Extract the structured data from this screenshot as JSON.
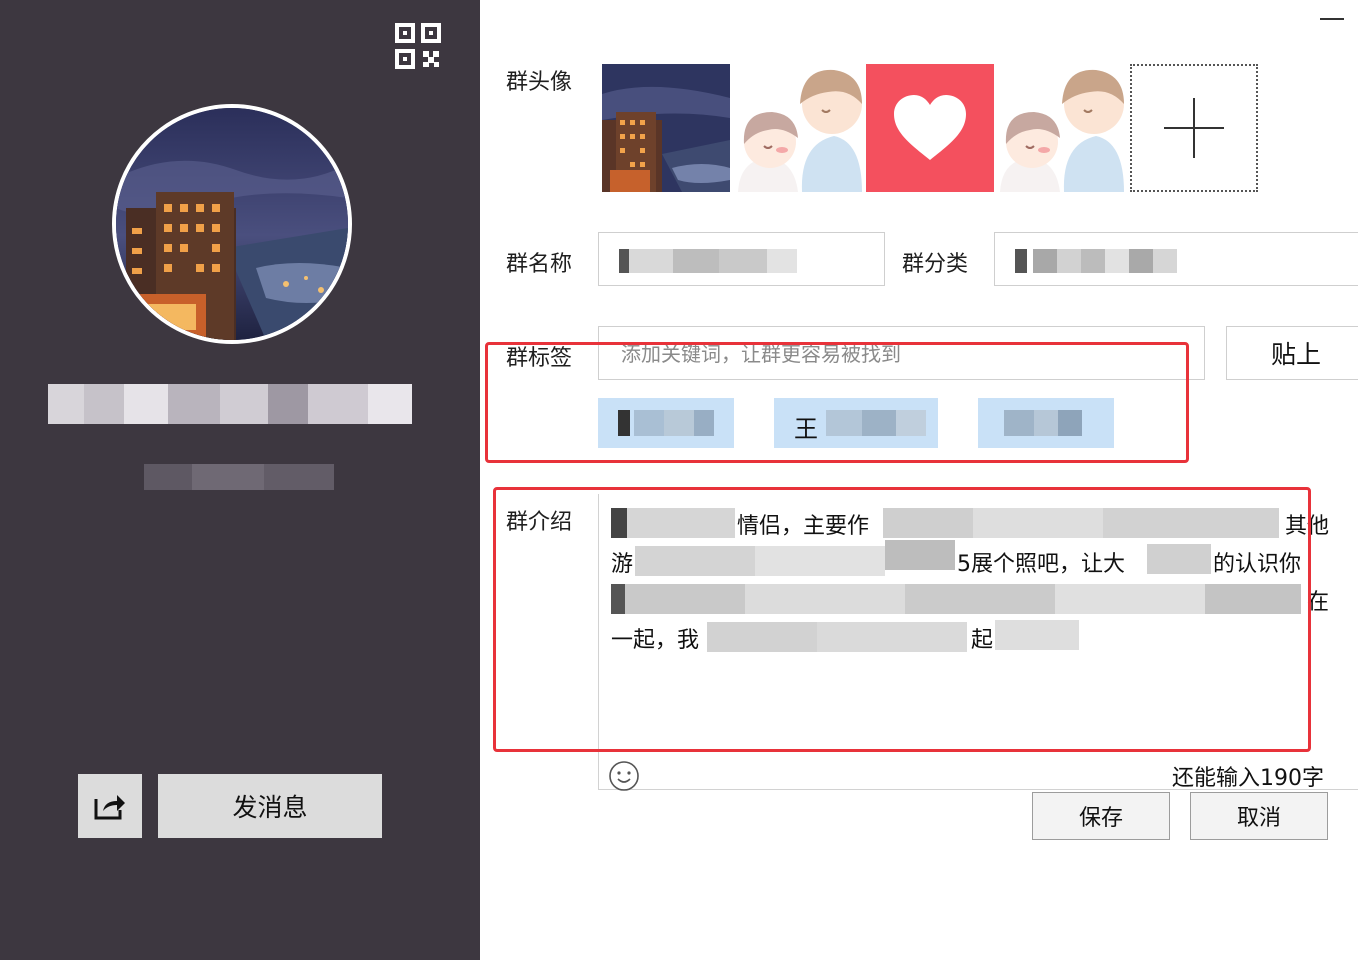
{
  "profile": {
    "qr_icon": "qr-code-icon",
    "share_icon": "share-icon",
    "send_message_label": "发消息"
  },
  "form": {
    "avatar_label": "群头像",
    "avatar_options": [
      "scenic-photo",
      "couple-cartoon",
      "heart-icon",
      "couple-cartoon",
      "add-icon"
    ],
    "name_label": "群名称",
    "category_label": "群分类",
    "tags_label": "群标签",
    "tags_placeholder": "添加关键词，让群更容易被找到",
    "paste_label": "贴上",
    "tag_chip_2_lead": "王",
    "intro_label": "群介绍",
    "intro_line_1_a": "情侣，主要作",
    "intro_line_1_b": "其他",
    "intro_line_2_a": "游",
    "intro_line_2_b": "5展个照吧，让大",
    "intro_line_2_c": "的认识你",
    "intro_line_3_b": "在",
    "intro_line_4_a": "一起，我",
    "intro_line_4_b": "起",
    "emoji_icon": "smiley-icon",
    "char_counter": "还能输入190字",
    "save_label": "保存",
    "cancel_label": "取消"
  },
  "colors": {
    "left_panel_bg": "#3d3740",
    "highlight_red": "#e8323a",
    "tag_bg": "#c9e1f7",
    "heart_bg": "#f4505e"
  }
}
